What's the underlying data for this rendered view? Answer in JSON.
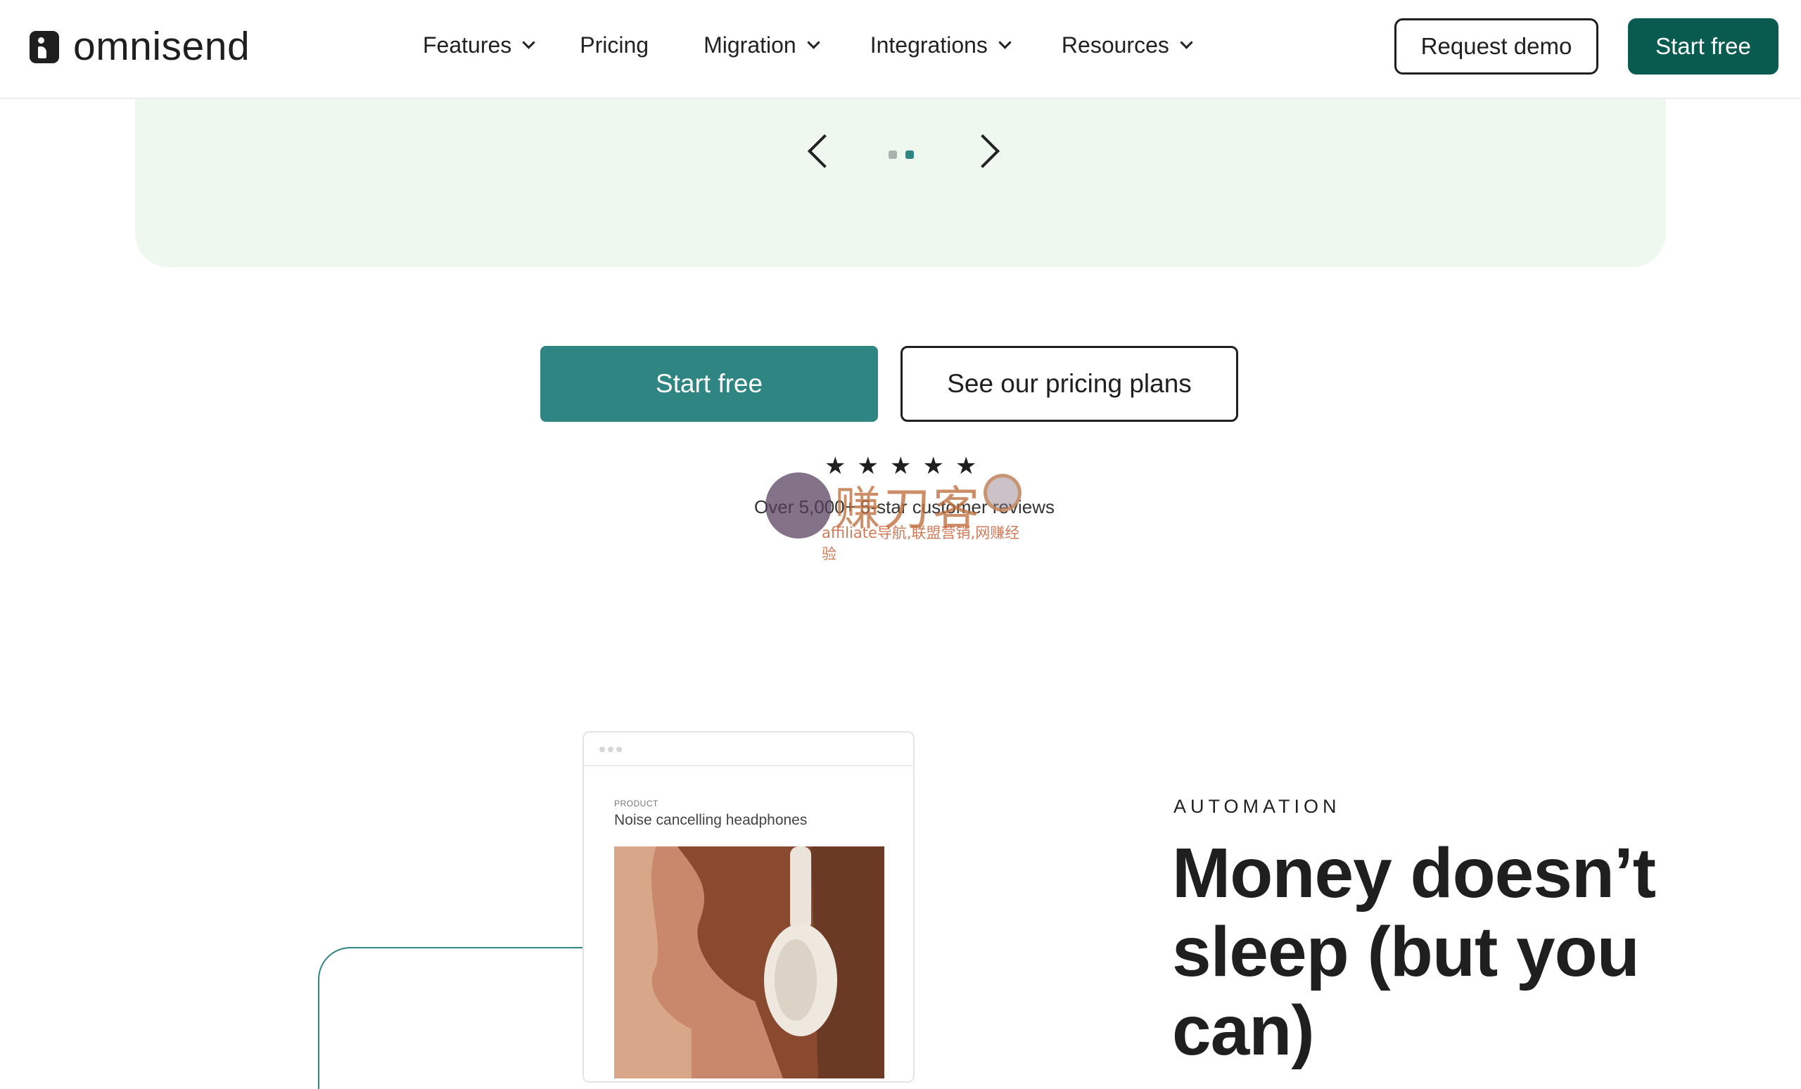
{
  "header": {
    "logo_text": "omnisend",
    "nav": [
      {
        "label": "Features",
        "has_dropdown": true
      },
      {
        "label": "Pricing",
        "has_dropdown": false
      },
      {
        "label": "Migration",
        "has_dropdown": true
      },
      {
        "label": "Integrations",
        "has_dropdown": true
      },
      {
        "label": "Resources",
        "has_dropdown": true
      }
    ],
    "request_demo_label": "Request demo",
    "start_free_label": "Start free"
  },
  "carousel": {
    "page_count": 2,
    "active_index": 1
  },
  "cta": {
    "primary_label": "Start free",
    "secondary_label": "See our pricing plans"
  },
  "rating": {
    "stars": 5,
    "reviews_text": "Over 5,000+ 5-star customer reviews"
  },
  "watermark": {
    "big_text": "赚刀客",
    "small_text": "affiliate导航,联盟营销,网赚经验"
  },
  "product_card": {
    "eyebrow": "PRODUCT",
    "title": "Noise cancelling headphones"
  },
  "automation": {
    "eyebrow": "AUTOMATION",
    "headline": "Money doesn’t sleep (but you can)"
  },
  "colors": {
    "brand_dark_green": "#095b4f",
    "teal": "#2f8582",
    "mint_panel": "#eef8ef",
    "text_dark": "#1f1f1f"
  }
}
